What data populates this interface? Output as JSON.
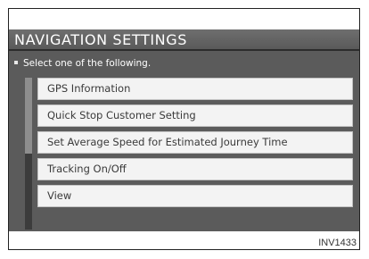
{
  "screen": {
    "title": "NAVIGATION SETTINGS",
    "instruction": "Select one of the following.",
    "scroll_fraction_visible": 0.5
  },
  "menu": {
    "items": [
      {
        "label": "GPS Information"
      },
      {
        "label": "Quick Stop Customer Setting"
      },
      {
        "label": "Set Average Speed for Estimated Journey Time"
      },
      {
        "label": "Tracking On/Off"
      },
      {
        "label": "View"
      }
    ]
  },
  "figure_code": "INV1433",
  "colors": {
    "screen_background": "#5b5b5b",
    "item_background": "#f3f3f3",
    "item_text": "#3a3a3a",
    "title_text": "#ffffff"
  }
}
